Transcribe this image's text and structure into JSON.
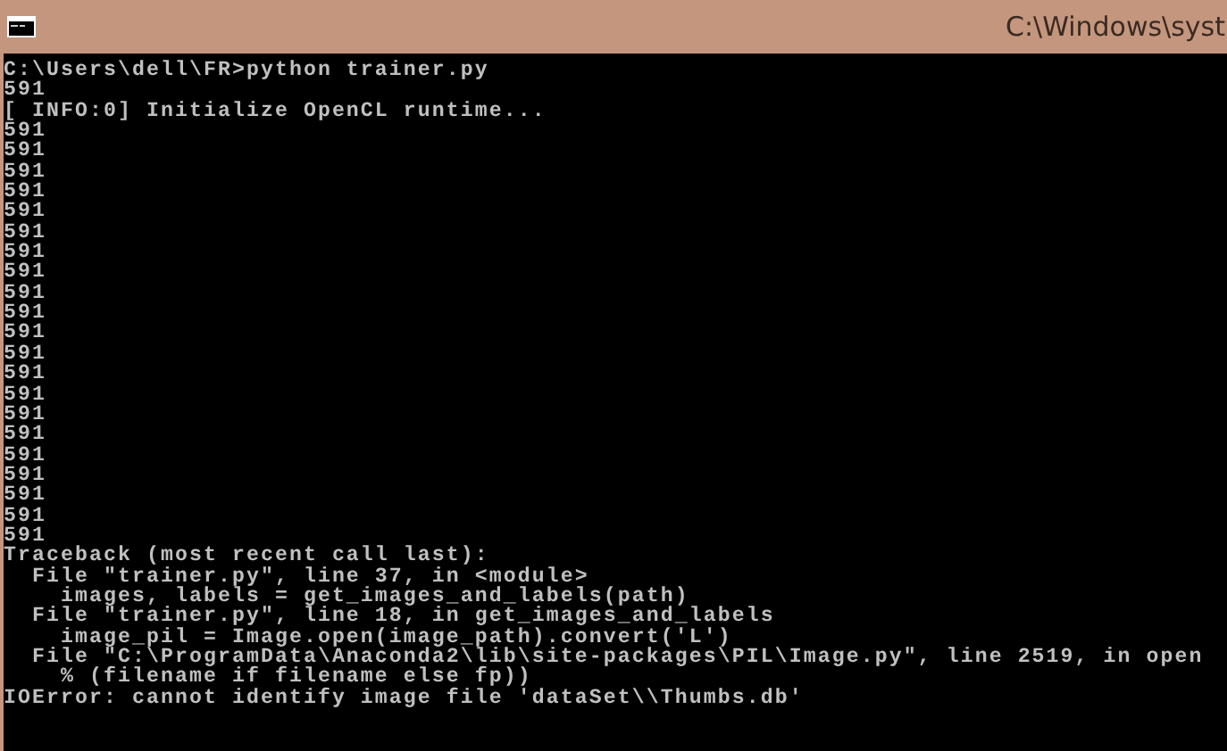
{
  "window": {
    "title": "C:\\Windows\\syst"
  },
  "console": {
    "lines": [
      "C:\\Users\\dell\\FR>python trainer.py",
      "591",
      "[ INFO:0] Initialize OpenCL runtime...",
      "591",
      "591",
      "591",
      "591",
      "591",
      "591",
      "591",
      "591",
      "591",
      "591",
      "591",
      "591",
      "591",
      "591",
      "591",
      "591",
      "591",
      "591",
      "591",
      "591",
      "591",
      "Traceback (most recent call last):",
      "  File \"trainer.py\", line 37, in <module>",
      "    images, labels = get_images_and_labels(path)",
      "  File \"trainer.py\", line 18, in get_images_and_labels",
      "    image_pil = Image.open(image_path).convert('L')",
      "  File \"C:\\ProgramData\\Anaconda2\\lib\\site-packages\\PIL\\Image.py\", line 2519, in open",
      "    % (filename if filename else fp))",
      "IOError: cannot identify image file 'dataSet\\\\Thumbs.db'"
    ]
  }
}
